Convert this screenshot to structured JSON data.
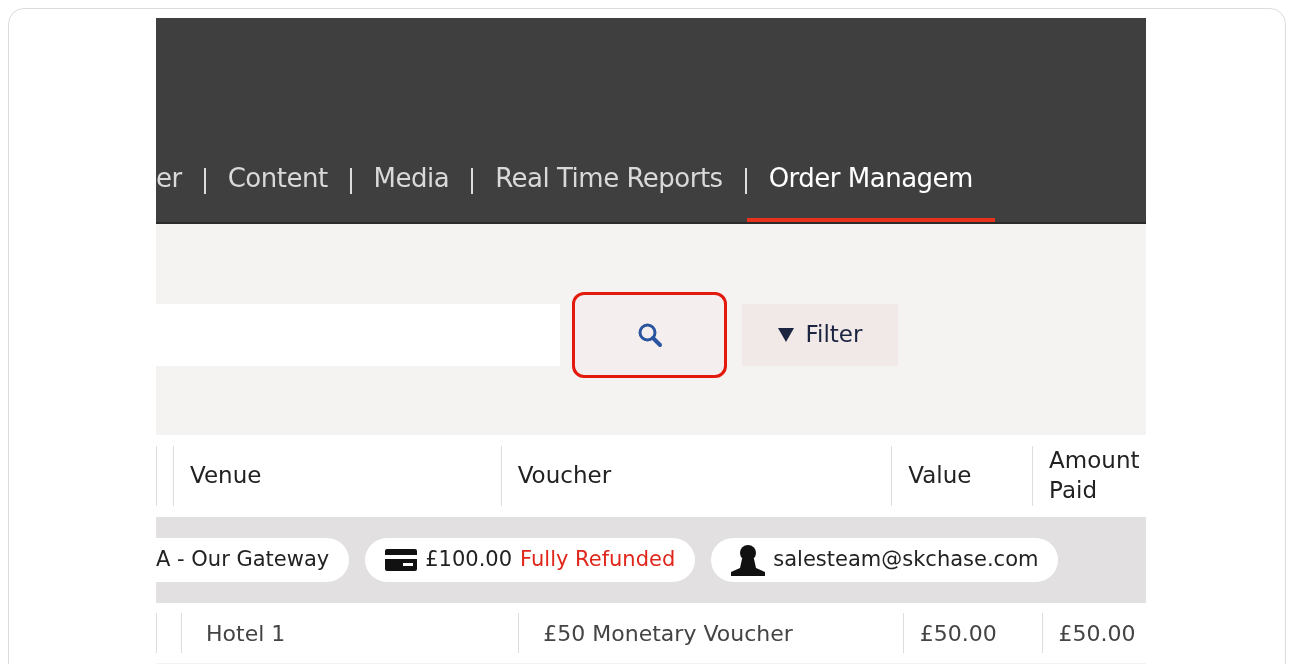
{
  "nav": {
    "tabs": [
      {
        "label": "er",
        "selected": false
      },
      {
        "label": "Content",
        "selected": false
      },
      {
        "label": "Media",
        "selected": false
      },
      {
        "label": "Real Time Reports",
        "selected": false
      },
      {
        "label": "Order Managem",
        "selected": true
      }
    ]
  },
  "toolbar": {
    "search_button": {
      "highlighted": true
    },
    "filter_button": {
      "label": "Filter"
    }
  },
  "table": {
    "columns": [
      "Venue",
      "Voucher",
      "Value",
      "Amount Paid"
    ],
    "group_row": {
      "venue": "A - Our Gateway",
      "amount": "£100.00",
      "status": "Fully Refunded",
      "email": "salesteam@skchase.com"
    },
    "rows": [
      {
        "cells": [
          "Hotel 1",
          "£50 Monetary Voucher",
          "£50.00",
          "£50.00"
        ]
      }
    ]
  }
}
